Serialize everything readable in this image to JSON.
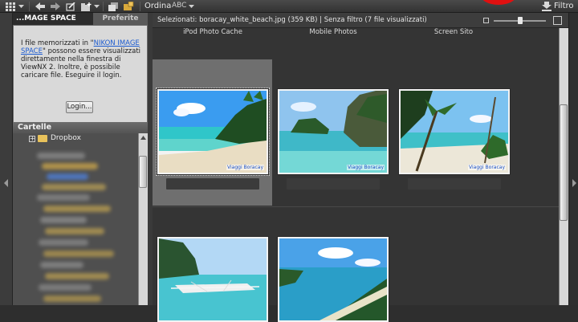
{
  "toolbar": {
    "sort_label": "Ordina",
    "sort_value": "ABC",
    "filter_label": "Filtro",
    "icons": [
      "grid-view-icon",
      "back-icon",
      "forward-icon",
      "edit-icon",
      "folder-add-icon",
      "stack-icon",
      "lock-icon",
      "dropdown-icon",
      "filter-download-icon"
    ]
  },
  "left_panel": {
    "tabs": [
      {
        "label": "...MAGE SPACE",
        "active": true
      },
      {
        "label": "Preferite",
        "active": false
      }
    ],
    "ims_message_before": "I file memorizzati in \"",
    "ims_link": "NIKON IMAGE SPACE",
    "ims_message_after": "\" possono essere visualizzati direttamente nella finestra di ViewNX 2. Inoltre, è possibile caricare file. Eseguire il login.",
    "login_label": "Login...",
    "folders_header": "Cartelle",
    "tree_first_item": "Dropbox"
  },
  "content": {
    "status_text": "Selezionati: boracay_white_beach.jpg (359 KB) | Senza filtro  (7 file visualizzati)",
    "captions": [
      "iPod Photo Cache",
      "Mobile Photos",
      "Screen Sito"
    ],
    "thumbnails": [
      {
        "name": "boracay_white_beach",
        "selected": true,
        "watermark": "Viaggi Boracay"
      },
      {
        "name": "island_cliff",
        "selected": false,
        "watermark": "Viaggi Boracay"
      },
      {
        "name": "palm_beach",
        "selected": false,
        "watermark": "Viaggi Boracay"
      },
      {
        "name": "outrigger_boat",
        "selected": false,
        "watermark": ""
      },
      {
        "name": "aerial_coast",
        "selected": false,
        "watermark": ""
      }
    ]
  },
  "colors": {
    "accent_link": "#1c5bd0",
    "panel_bg": "#4b4b4b",
    "content_bg": "#343434",
    "selection_bg": "#6f6f6f"
  }
}
